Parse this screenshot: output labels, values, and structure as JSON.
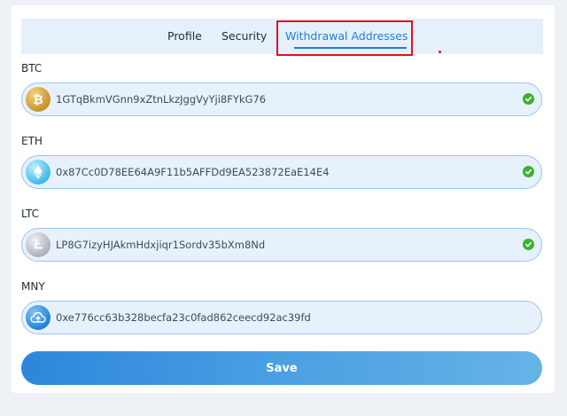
{
  "tabs": {
    "profile": "Profile",
    "security": "Security",
    "withdrawal": "Withdrawal Addresses"
  },
  "fields": [
    {
      "label": "BTC",
      "address": "1GTqBkmVGnn9xZtnLkzJggVyYji8FYkG76",
      "icon": "bitcoin-icon",
      "verified": true
    },
    {
      "label": "ETH",
      "address": "0x87Cc0D78EE64A9F11b5AFFDd9EA523872EaE14E4",
      "icon": "ethereum-icon",
      "verified": true
    },
    {
      "label": "LTC",
      "address": "LP8G7izyHJAkmHdxjiqr1Sordv35bXm8Nd",
      "icon": "litecoin-icon",
      "verified": true
    },
    {
      "label": "MNY",
      "address": "0xe776cc63b328becfa23c0fad862ceecd92ac39fd",
      "icon": "cloud-upload-icon",
      "verified": false
    }
  ],
  "save_label": "Save",
  "colors": {
    "accent": "#1e7fd9",
    "highlight": "#e0121b",
    "verified": "#3cb22b",
    "field_bg": "#e7f1fc"
  }
}
